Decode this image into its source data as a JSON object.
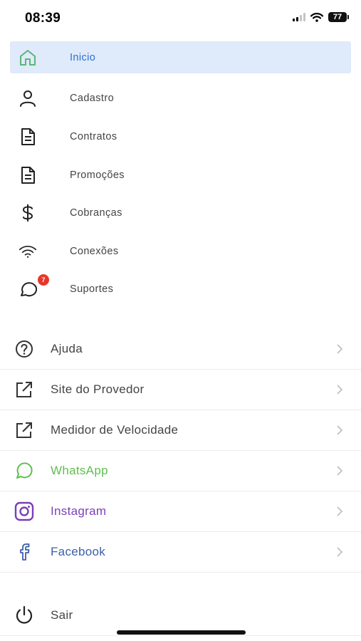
{
  "status": {
    "time": "08:39",
    "battery": "77"
  },
  "menu": {
    "items": [
      {
        "label": "Inicio",
        "icon": "home-icon",
        "active": true
      },
      {
        "label": "Cadastro",
        "icon": "user-icon"
      },
      {
        "label": "Contratos",
        "icon": "document-icon"
      },
      {
        "label": "Promoções",
        "icon": "document-icon"
      },
      {
        "label": "Cobranças",
        "icon": "dollar-icon"
      },
      {
        "label": "Conexões",
        "icon": "wifi-icon"
      },
      {
        "label": "Suportes",
        "icon": "chat-icon",
        "badge": "7"
      }
    ]
  },
  "links": [
    {
      "label": "Ajuda",
      "icon": "help-icon"
    },
    {
      "label": "Site do Provedor",
      "icon": "external-link-icon"
    },
    {
      "label": "Medidor de Velocidade",
      "icon": "external-link-icon"
    },
    {
      "label": "WhatsApp",
      "icon": "whatsapp-icon",
      "color": "#5fbf4e"
    },
    {
      "label": "Instagram",
      "icon": "instagram-icon",
      "color": "#7b3fb8"
    },
    {
      "label": "Facebook",
      "icon": "facebook-icon",
      "color": "#3b5fa8"
    }
  ],
  "logout": {
    "label": "Sair",
    "icon": "power-icon"
  },
  "colors": {
    "accent": "#2f6fd0",
    "active_bg": "#dfeafb",
    "home_icon": "#5bb574",
    "badge": "#e8362a"
  }
}
